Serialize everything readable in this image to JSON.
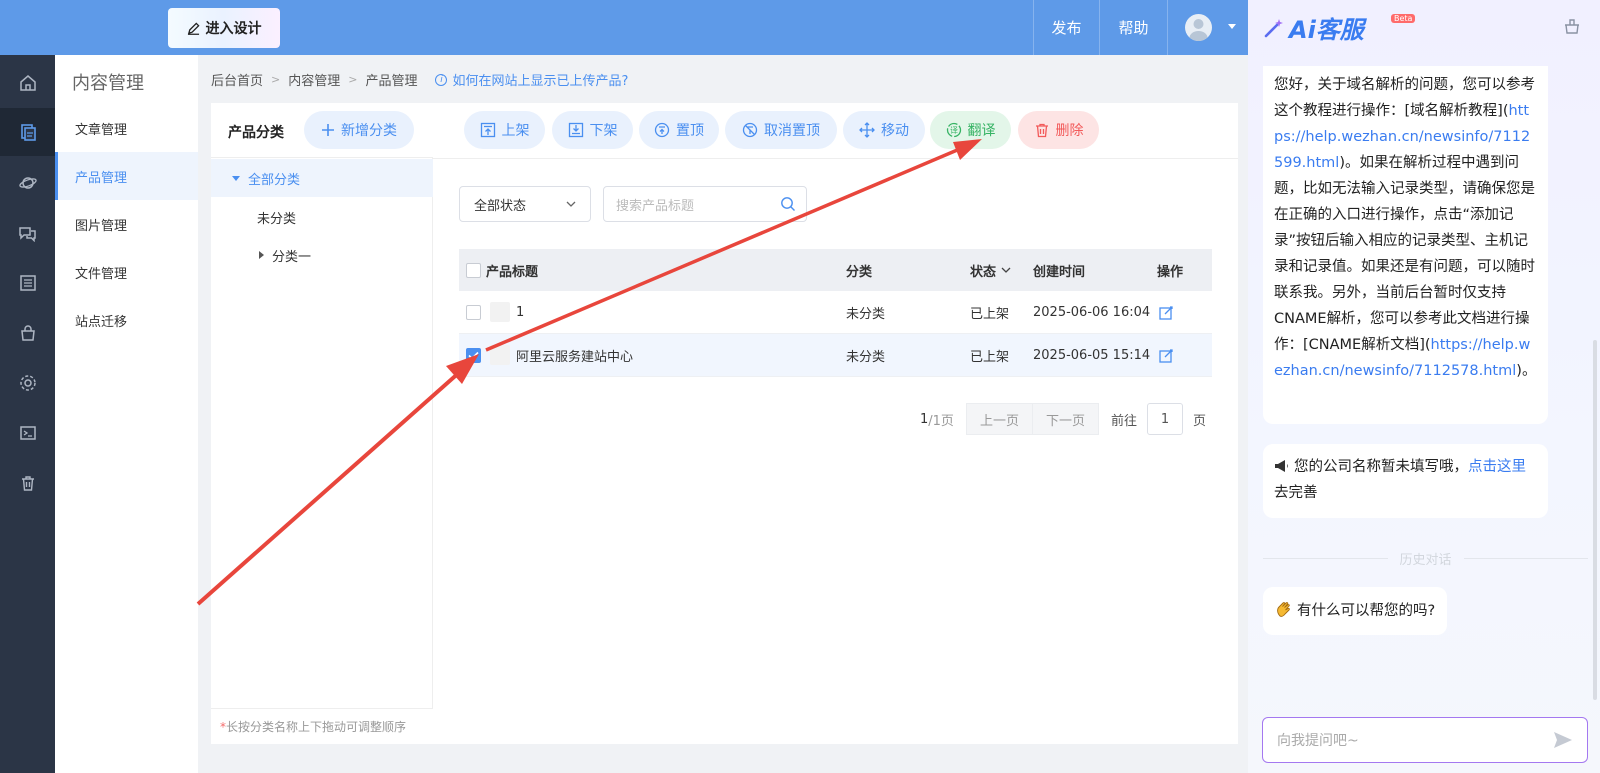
{
  "topbar": {
    "design_label": "进入设计",
    "publish": "发布",
    "help": "帮助"
  },
  "left_rail": {
    "icons": [
      "home-icon",
      "content-icon",
      "planet-icon",
      "chat-icon",
      "list-icon",
      "shop-icon",
      "settings-icon",
      "terminal-icon",
      "trash-icon"
    ]
  },
  "subnav": {
    "title": "内容管理",
    "items": [
      {
        "label": "文章管理",
        "active": false
      },
      {
        "label": "产品管理",
        "active": true
      },
      {
        "label": "图片管理",
        "active": false
      },
      {
        "label": "文件管理",
        "active": false
      },
      {
        "label": "站点迁移",
        "active": false
      }
    ]
  },
  "breadcrumb": {
    "items": [
      "后台首页",
      "内容管理",
      "产品管理"
    ],
    "help_link": "如何在网站上显示已上传产品?"
  },
  "category_panel": {
    "title": "产品分类",
    "add_button": "新增分类",
    "items": [
      {
        "label": "全部分类",
        "active": true,
        "expanded": true
      },
      {
        "label": "未分类",
        "active": false
      },
      {
        "label": "分类一",
        "active": false,
        "collapsed": true
      }
    ],
    "hint_star": "*",
    "hint": "长按分类名称上下拖动可调整顺序"
  },
  "toolbar": {
    "buttons": [
      {
        "label": "上架",
        "icon": "upload-icon",
        "color": "#4a8ff0"
      },
      {
        "label": "下架",
        "icon": "download-icon",
        "color": "#4a8ff0"
      },
      {
        "label": "置顶",
        "icon": "pin-top-icon",
        "color": "#4a8ff0"
      },
      {
        "label": "取消置顶",
        "icon": "unpin-icon",
        "color": "#4a8ff0"
      },
      {
        "label": "移动",
        "icon": "move-icon",
        "color": "#4a8ff0"
      },
      {
        "label": "翻译",
        "icon": "translate-icon",
        "color": "#36b364"
      },
      {
        "label": "删除",
        "icon": "trash-icon",
        "color": "#f25a5a"
      }
    ]
  },
  "filters": {
    "status_value": "全部状态",
    "search_placeholder": "搜索产品标题"
  },
  "table": {
    "columns": [
      "产品标题",
      "分类",
      "状态",
      "创建时间",
      "操作"
    ],
    "rows": [
      {
        "title": "1",
        "category": "未分类",
        "status": "已上架",
        "created": "2025-06-06 16:04",
        "checked": false
      },
      {
        "title": "阿里云服务建站中心",
        "category": "未分类",
        "status": "已上架",
        "created": "2025-06-05 15:14",
        "checked": true
      }
    ]
  },
  "pagination": {
    "current": "1",
    "total": "/1页",
    "prev": "上一页",
    "next": "下一页",
    "goto": "前往",
    "page_value": "1",
    "page_unit": "页"
  },
  "chat": {
    "logo_text": "Ai客服",
    "beta": "Beta",
    "message_1_part1": "您好，关于域名解析的问题，您可以参考这个教程进行操作：[域名解析教程](",
    "message_1_link1": "https://help.wezhan.cn/newsinfo/7112599.html",
    "message_1_part2": ")。如果在解析过程中遇到问题，比如无法输入记录类型，请确保您是在正确的入口进行操作，点击“添加记录”按钮后输入相应的记录类型、主机记录和记录值。如果还是有问题，可以随时联系我。另外，当前后台暂时仅支持CNAME解析，您可以参考此文档进行操作：[CNAME解析文档](",
    "message_1_link2": "https://help.wezhan.cn/newsinfo/7112578.html",
    "message_1_part3": ")。",
    "message_2_text": "您的公司名称暂未填写哦，",
    "message_2_link": "点击这里",
    "message_2_tail": " 去完善",
    "history_divider": "历史对话",
    "message_3": "有什么可以帮您的吗?",
    "input_placeholder": "向我提问吧~"
  },
  "colors": {
    "topbar": "#5e9ae8",
    "rail": "#2b3546",
    "accent": "#4a8ff0",
    "annotation_arrow": "#e8463c"
  }
}
